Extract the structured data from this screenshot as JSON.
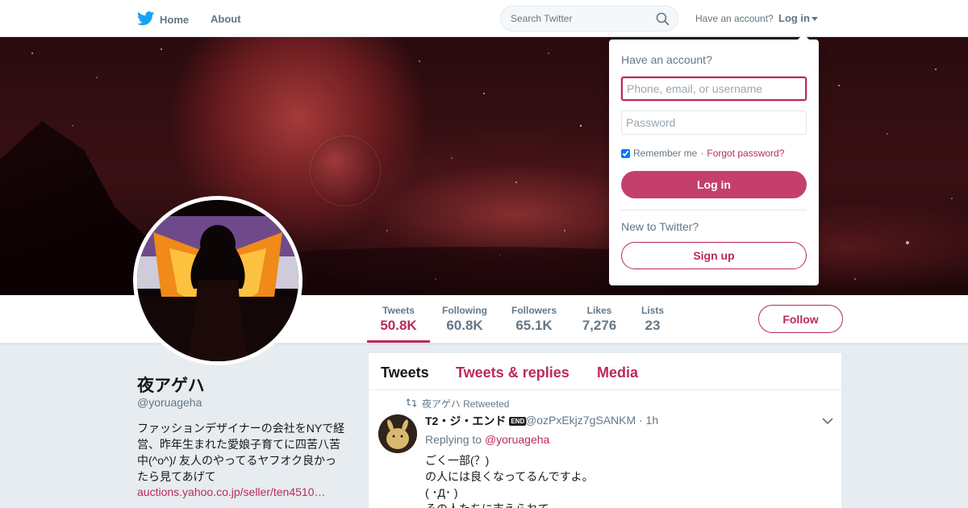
{
  "colors": {
    "accent": "#bb2a5a",
    "twitter_blue": "#1da1f2",
    "muted": "#657786"
  },
  "nav": {
    "home_label": "Home",
    "about_label": "About",
    "search_placeholder": "Search Twitter",
    "have_account": "Have an account?",
    "login_label": "Log in"
  },
  "stats": {
    "tweets": {
      "label": "Tweets",
      "value": "50.8K"
    },
    "following": {
      "label": "Following",
      "value": "60.8K"
    },
    "followers": {
      "label": "Followers",
      "value": "65.1K"
    },
    "likes": {
      "label": "Likes",
      "value": "7,276"
    },
    "lists": {
      "label": "Lists",
      "value": "23"
    },
    "follow_button": "Follow"
  },
  "profile": {
    "name": "夜アゲハ",
    "handle": "@yoruageha",
    "bio_lines": [
      "ファッションデザイナーの会社をNYで経",
      "営、昨年生まれた愛娘子育てに四苦八苦",
      "中(^o^)/ 友人のやってるヤフオク良かっ",
      "たら見てあげて"
    ],
    "link": "auctions.yahoo.co.jp/seller/ten4510…"
  },
  "timeline": {
    "tabs": [
      "Tweets",
      "Tweets & replies",
      "Media"
    ],
    "tweet": {
      "retweeted_by": "夜アゲハ Retweeted",
      "author": "T2・ジ・エンド",
      "author_badge": "END",
      "handle": "@ozPxEkjz7gSANKM",
      "time": "· 1h",
      "replying_prefix": "Replying to",
      "replying_to": "@yoruageha",
      "text_lines": [
        "ごく一部(？)",
        "の人には良くなってるんですよ。",
        "( ･Д･ )",
        "その人たちに支えられて"
      ]
    }
  },
  "login_dropdown": {
    "title": "Have an account?",
    "username_placeholder": "Phone, email, or username",
    "password_placeholder": "Password",
    "remember_label": "Remember me",
    "separator": "·",
    "forgot_label": "Forgot password?",
    "login_button": "Log in",
    "new_label": "New to Twitter?",
    "signup_button": "Sign up"
  }
}
